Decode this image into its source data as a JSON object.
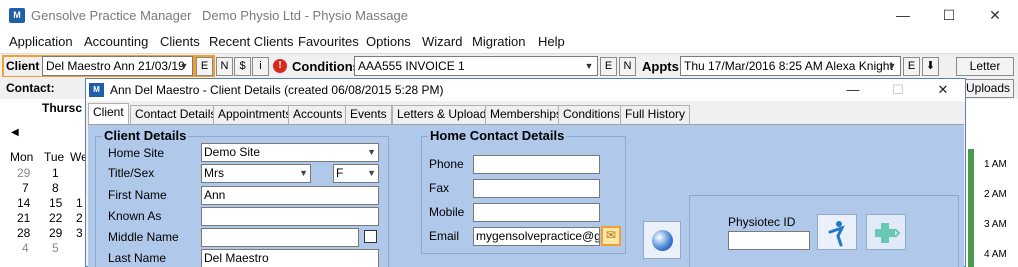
{
  "app": {
    "title": "Gensolve Practice Manager",
    "subtitle": "Demo Physio Ltd - Physio Massage",
    "logo_text": "M"
  },
  "window_controls": {
    "minimize": "—",
    "maximize": "☐",
    "close": "✕"
  },
  "menu": [
    "Application",
    "Accounting",
    "Clients",
    "Recent Clients",
    "Favourites",
    "Options",
    "Wizard",
    "Migration",
    "Help"
  ],
  "toolbar": {
    "client_label": "Client",
    "client_value": "Del Maestro Ann 21/03/19",
    "client_buttons": [
      "E",
      "N",
      "$",
      "i"
    ],
    "alert_icon": "!",
    "conditions_label": "Conditions",
    "conditions_value": "AAA555 INVOICE 1",
    "conditions_buttons": [
      "E",
      "N"
    ],
    "appts_label": "Appts",
    "appts_value": "Thu 17/Mar/2016  8:25 AM Alexa Knight",
    "appts_edit": "E",
    "appts_download": "⬇",
    "letter_button": "Letter"
  },
  "row2": {
    "contact_label": "Contact:",
    "uploads_button": "Uploads"
  },
  "calendar": {
    "header": "Thursc",
    "nav_prev": "◀",
    "day_heads": [
      "Mon",
      "Tue",
      "We"
    ],
    "weeks": [
      [
        "29",
        "1",
        ""
      ],
      [
        "7",
        "8",
        ""
      ],
      [
        "14",
        "15",
        "1"
      ],
      [
        "21",
        "22",
        "2"
      ],
      [
        "28",
        "29",
        "3"
      ],
      [
        "4",
        "5",
        ""
      ]
    ]
  },
  "time_labels": [
    "1 AM",
    "2 AM",
    "3 AM",
    "4 AM"
  ],
  "dialog": {
    "logo_text": "M",
    "title": "Ann Del Maestro - Client Details (created 06/08/2015 5:28 PM)",
    "controls": {
      "minimize": "—",
      "maximize": "☐",
      "close": "✕"
    },
    "tabs": [
      "Client",
      "Contact Details",
      "Appointments",
      "Accounts",
      "Events",
      "Letters & Uploads",
      "Memberships",
      "Conditions",
      "Full History"
    ],
    "active_tab": "Client",
    "client_details": {
      "title": "Client Details",
      "home_site_label": "Home Site",
      "home_site_value": "Demo Site",
      "title_sex_label": "Title/Sex",
      "title_value": "Mrs",
      "sex_value": "F",
      "first_name_label": "First Name",
      "first_name_value": "Ann",
      "known_as_label": "Known As",
      "known_as_value": "",
      "middle_name_label": "Middle Name",
      "middle_name_value": "",
      "last_name_label": "Last Name",
      "last_name_value": "Del Maestro"
    },
    "home_contact": {
      "title": "Home Contact Details",
      "phone_label": "Phone",
      "phone_value": "",
      "fax_label": "Fax",
      "fax_value": "",
      "mobile_label": "Mobile",
      "mobile_value": "",
      "email_label": "Email",
      "email_value": "mygensolvepractice@gen",
      "mail_icon": "✉"
    },
    "physiotec": {
      "label": "Physiotec ID",
      "value": ""
    }
  },
  "colors": {
    "panel_bg": "#b0c8ea",
    "highlight": "#f0a030",
    "brand": "#1f5fa8"
  }
}
